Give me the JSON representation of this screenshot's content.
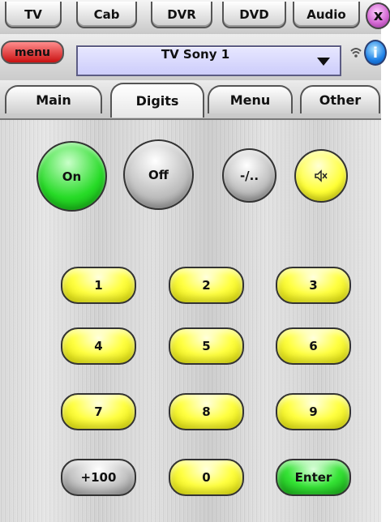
{
  "top_tabs": [
    "TV",
    "Cab",
    "DVR",
    "DVD",
    "Audio"
  ],
  "close_label": "x",
  "menu_button": "menu",
  "device_selector": "TV Sony 1",
  "info_label": "i",
  "function_tabs": [
    "Main",
    "Digits",
    "Menu",
    "Other"
  ],
  "controls": {
    "on": "On",
    "off": "Off",
    "dash_dot": "-/..",
    "mute_icon": "mute-icon"
  },
  "keypad": [
    "1",
    "2",
    "3",
    "4",
    "5",
    "6",
    "7",
    "8",
    "9",
    "+100",
    "0",
    "Enter"
  ]
}
